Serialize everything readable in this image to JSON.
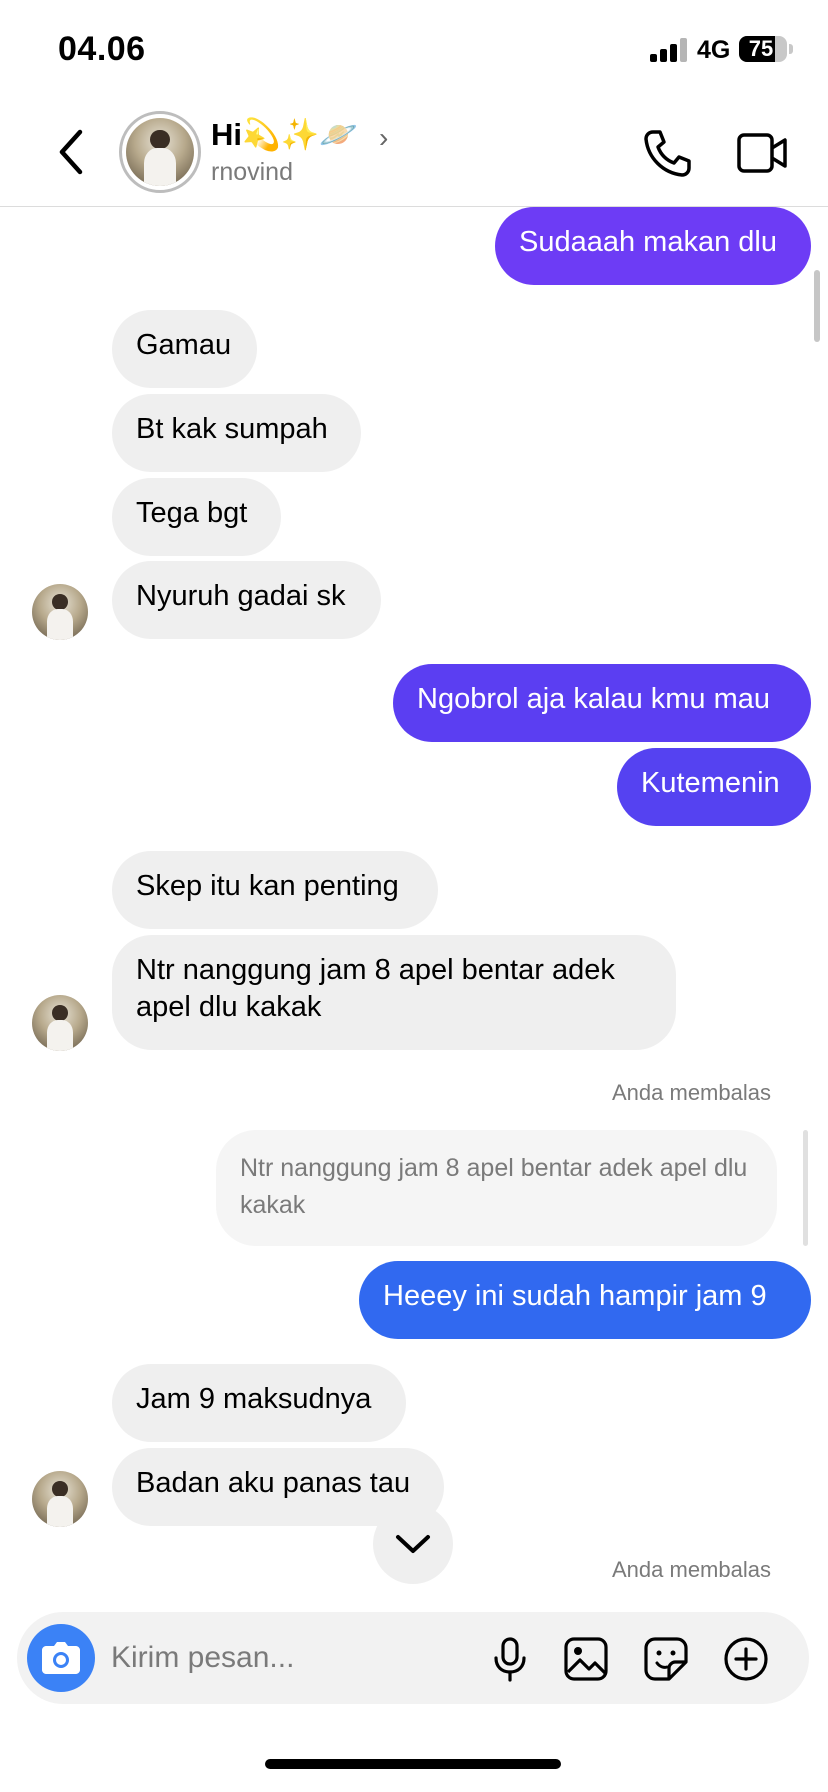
{
  "status_bar": {
    "time": "04.06",
    "network": "4G",
    "battery_percent": "75",
    "battery_level": 0.75
  },
  "header": {
    "contact_name": "Hi💫✨🪐",
    "name_chevron": "›",
    "username": "rnovind"
  },
  "messages": [
    {
      "from": "me",
      "text": "Sudaaah makan dlu",
      "color": "#6d3cf5"
    },
    {
      "from": "them",
      "text": "Gamau"
    },
    {
      "from": "them",
      "text": "Bt kak sumpah"
    },
    {
      "from": "them",
      "text": "Tega bgt"
    },
    {
      "from": "them",
      "text": "Nyuruh gadai sk"
    },
    {
      "from": "me",
      "text": "Ngobrol aja kalau kmu mau",
      "color": "#5b3ef2"
    },
    {
      "from": "me",
      "text": "Kutemenin",
      "color": "#5542f1"
    },
    {
      "from": "them",
      "text": "Skep itu kan penting"
    },
    {
      "from": "them",
      "text": "Ntr nanggung jam 8 apel bentar adek apel dlu kakak"
    },
    {
      "from": "me",
      "reply_label": "Anda membalas",
      "quoted": "Ntr nanggung jam 8 apel bentar adek apel dlu kakak",
      "text": "Heeey ini sudah hampir jam 9",
      "color": "#3169f0"
    },
    {
      "from": "them",
      "text": "Jam 9 maksudnya"
    },
    {
      "from": "them",
      "text": "Badan aku panas tau"
    },
    {
      "from": "me",
      "reply_label": "Anda membalas"
    }
  ],
  "composer": {
    "placeholder": "Kirim pesan..."
  },
  "colors": {
    "camera_button": "#3b82f6",
    "incoming_bubble": "#efefef"
  }
}
